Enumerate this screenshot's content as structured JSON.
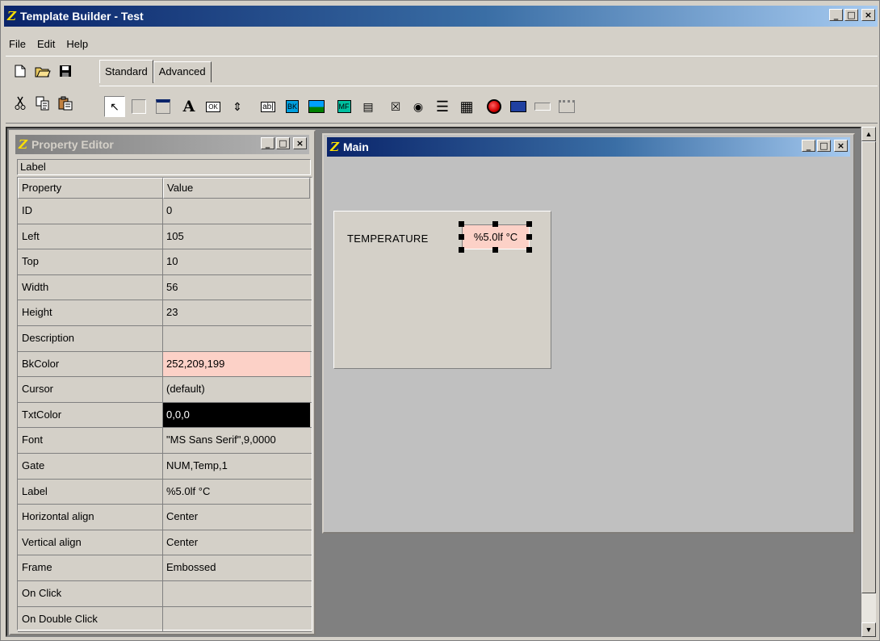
{
  "app": {
    "title": "Template Builder - Test",
    "logo": "Z",
    "window_controls": [
      "_",
      "□",
      "×"
    ]
  },
  "menu": [
    "File",
    "Edit",
    "Help"
  ],
  "toolbar": {
    "file_icons": [
      "new-document-icon",
      "open-folder-icon",
      "save-disk-icon"
    ],
    "edit_icons": [
      "cut-scissors-icon",
      "copy-icon",
      "paste-icon"
    ],
    "tabs": [
      "Standard",
      "Advanced"
    ],
    "active_tab": "Standard",
    "palette": [
      {
        "name": "pointer-tool",
        "glyph": "↖"
      },
      {
        "name": "panel-tool",
        "glyph": ""
      },
      {
        "name": "frame-tool",
        "glyph": ""
      },
      {
        "name": "label-tool",
        "glyph": "A"
      },
      {
        "name": "button-tool",
        "glyph": "OK"
      },
      {
        "name": "spinner-tool",
        "glyph": "⇕"
      },
      {
        "name": "edit-field-tool",
        "glyph": "ab|"
      },
      {
        "name": "bitmap-tool",
        "glyph": "BK"
      },
      {
        "name": "picture-tool",
        "glyph": "▰"
      },
      {
        "name": "metafile-tool",
        "glyph": "MF"
      },
      {
        "name": "gauge-tool",
        "glyph": "▤"
      },
      {
        "name": "checkbox-tool",
        "glyph": "☒"
      },
      {
        "name": "radio-tool",
        "glyph": "◉"
      },
      {
        "name": "list-tool",
        "glyph": "☰"
      },
      {
        "name": "combo-tool",
        "glyph": "▦"
      },
      {
        "name": "led-tool",
        "glyph": "●"
      },
      {
        "name": "image-button-tool",
        "glyph": "▣"
      },
      {
        "name": "separator-tool",
        "glyph": "▭"
      },
      {
        "name": "tabpage-tool",
        "glyph": "▯"
      }
    ]
  },
  "property_editor": {
    "title": "Property Editor",
    "object": "Label",
    "headers": {
      "property": "Property",
      "value": "Value"
    },
    "rows": [
      {
        "property": "ID",
        "value": "0"
      },
      {
        "property": "Left",
        "value": "105"
      },
      {
        "property": "Top",
        "value": "10"
      },
      {
        "property": "Width",
        "value": "56"
      },
      {
        "property": "Height",
        "value": "23"
      },
      {
        "property": "Description",
        "value": ""
      },
      {
        "property": "BkColor",
        "value": "252,209,199"
      },
      {
        "property": "Cursor",
        "value": "(default)"
      },
      {
        "property": "TxtColor",
        "value": "0,0,0"
      },
      {
        "property": "Font",
        "value": "\"MS Sans Serif\",9,0000"
      },
      {
        "property": "Gate",
        "value": "NUM,Temp,1"
      },
      {
        "property": "Label",
        "value": "%5.0lf °C"
      },
      {
        "property": "Horizontal align",
        "value": "Center"
      },
      {
        "property": "Vertical align",
        "value": "Center"
      },
      {
        "property": "Frame",
        "value": "Embossed"
      },
      {
        "property": "On Click",
        "value": ""
      },
      {
        "property": "On Double Click",
        "value": ""
      }
    ]
  },
  "main_window": {
    "title": "Main",
    "temperature_label": "TEMPERATURE",
    "temperature_value": "%5.0lf °C"
  },
  "colors": {
    "titlebar_active": "#0a246a",
    "titlebar_inactive": "#808080",
    "label_bk": "#fcd1c7",
    "face": "#d4d0c8"
  }
}
